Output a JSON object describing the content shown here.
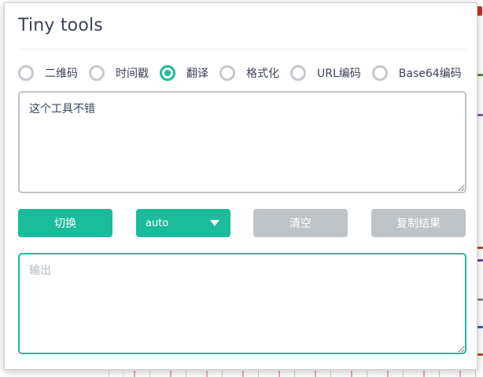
{
  "app": {
    "title": "Tiny tools"
  },
  "tools": [
    {
      "label": "二维码",
      "checked": false
    },
    {
      "label": "时间戳",
      "checked": false
    },
    {
      "label": "翻译",
      "checked": true
    },
    {
      "label": "格式化",
      "checked": false
    },
    {
      "label": "URL编码",
      "checked": false
    },
    {
      "label": "Base64编码",
      "checked": false
    }
  ],
  "input": {
    "value": "这个工具不错"
  },
  "controls": {
    "switch_label": "切换",
    "language_selected": "auto",
    "clear_label": "清空",
    "copy_label": "复制结果"
  },
  "output": {
    "value": "",
    "placeholder": "输出"
  },
  "colors": {
    "accent": "#1abc9c",
    "disabled": "#bdc3c7",
    "text": "#3b4255"
  }
}
